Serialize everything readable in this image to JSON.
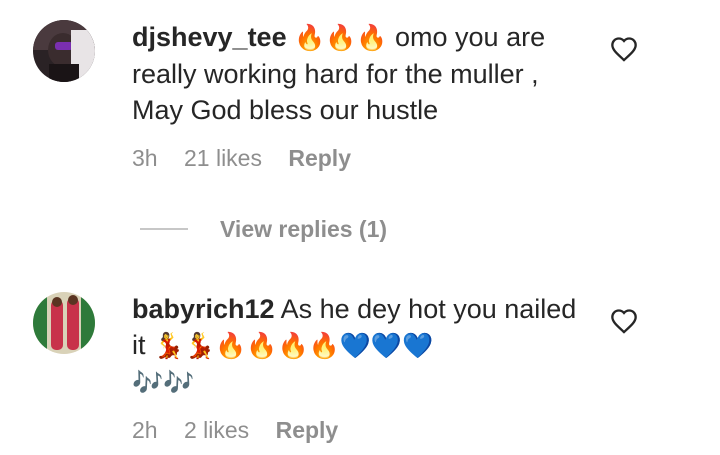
{
  "comments": [
    {
      "username": "djshevy_tee",
      "emojis_1": "🔥🔥🔥",
      "text": "omo you are really working hard for the muller , May God bless our hustle",
      "time": "3h",
      "likes": "21 likes",
      "reply_label": "Reply",
      "avatar_icon": "profile-photo",
      "like_icon": "heart-outline"
    },
    {
      "username": "babyrich12",
      "text_1": "As he dey hot you nailed it",
      "emojis_1": "💃💃🔥🔥🔥🔥💙💙💙",
      "emojis_2": "🎶🎶",
      "time": "2h",
      "likes": "2 likes",
      "reply_label": "Reply",
      "avatar_icon": "profile-photo",
      "like_icon": "heart-outline"
    }
  ],
  "view_replies": {
    "label": "View replies (1)"
  },
  "colors": {
    "text": "#262626",
    "secondary": "#8e8e8e",
    "divider": "#c7c7c7"
  }
}
